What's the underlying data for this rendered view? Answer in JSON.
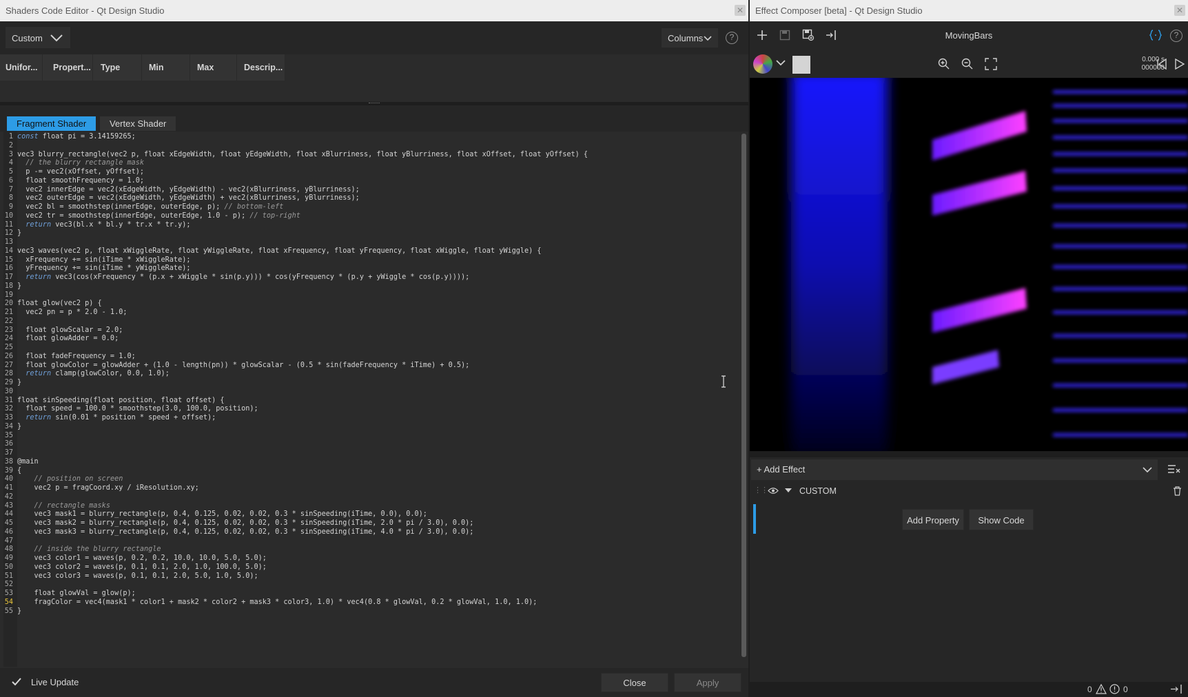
{
  "left_window": {
    "title": "Shaders Code Editor - Qt Design Studio",
    "close_glyph": "✕",
    "mode_combo": "Custom",
    "columns_button": "Columns",
    "help_glyph": "?",
    "table_headers": [
      "Unifor...",
      "Propert...",
      "Type",
      "Min",
      "Max",
      "Descrip..."
    ],
    "tabs": [
      "Fragment Shader",
      "Vertex Shader"
    ],
    "live_update_label": "Live Update",
    "close_button": "Close",
    "apply_button": "Apply",
    "current_line": 54
  },
  "code_lines": [
    "const float pi = 3.14159265;",
    "",
    "vec3 blurry_rectangle(vec2 p, float xEdgeWidth, float yEdgeWidth, float xBlurriness, float yBlurriness, float xOffset, float yOffset) {",
    "  // the blurry rectangle mask",
    "  p -= vec2(xOffset, yOffset);",
    "  float smoothFrequency = 1.0;",
    "  vec2 innerEdge = vec2(xEdgeWidth, yEdgeWidth) - vec2(xBlurriness, yBlurriness);",
    "  vec2 outerEdge = vec2(xEdgeWidth, yEdgeWidth) + vec2(xBlurriness, yBlurriness);",
    "  vec2 bl = smoothstep(innerEdge, outerEdge, p); // bottom-left",
    "  vec2 tr = smoothstep(innerEdge, outerEdge, 1.0 - p); // top-right",
    "  return vec3(bl.x * bl.y * tr.x * tr.y);",
    "}",
    "",
    "vec3 waves(vec2 p, float xWiggleRate, float yWiggleRate, float xFrequency, float yFrequency, float xWiggle, float yWiggle) {",
    "  xFrequency += sin(iTime * xWiggleRate);",
    "  yFrequency += sin(iTime * yWiggleRate);",
    "  return vec3(cos(xFrequency * (p.x + xWiggle * sin(p.y))) * cos(yFrequency * (p.y + yWiggle * cos(p.y))));",
    "}",
    "",
    "float glow(vec2 p) {",
    "  vec2 pn = p * 2.0 - 1.0;",
    "",
    "  float glowScalar = 2.0;",
    "  float glowAdder = 0.0;",
    "",
    "  float fadeFrequency = 1.0;",
    "  float glowColor = glowAdder + (1.0 - length(pn)) * glowScalar - (0.5 * sin(fadeFrequency * iTime) + 0.5);",
    "  return clamp(glowColor, 0.0, 1.0);",
    "}",
    "",
    "float sinSpeeding(float position, float offset) {",
    "  float speed = 100.0 * smoothstep(3.0, 100.0, position);",
    "  return sin(0.01 * position * speed + offset);",
    "}",
    "",
    "",
    "",
    "@main",
    "{",
    "    // position on screen",
    "    vec2 p = fragCoord.xy / iResolution.xy;",
    "",
    "    // rectangle masks",
    "    vec3 mask1 = blurry_rectangle(p, 0.4, 0.125, 0.02, 0.02, 0.3 * sinSpeeding(iTime, 0.0), 0.0);",
    "    vec3 mask2 = blurry_rectangle(p, 0.4, 0.125, 0.02, 0.02, 0.3 * sinSpeeding(iTime, 2.0 * pi / 3.0), 0.0);",
    "    vec3 mask3 = blurry_rectangle(p, 0.4, 0.125, 0.02, 0.02, 0.3 * sinSpeeding(iTime, 4.0 * pi / 3.0), 0.0);",
    "",
    "    // inside the blurry rectangle",
    "    vec3 color1 = waves(p, 0.2, 0.2, 10.0, 10.0, 5.0, 5.0);",
    "    vec3 color2 = waves(p, 0.1, 0.1, 2.0, 1.0, 100.0, 5.0);",
    "    vec3 color3 = waves(p, 0.1, 0.1, 2.0, 5.0, 1.0, 5.0);",
    "",
    "    float glowVal = glow(p);",
    "    fragColor = vec4(mask1 * color1 + mask2 * color2 + mask3 * color3, 1.0) * vec4(0.8 * glowVal, 0.2 * glowVal, 1.0, 1.0);",
    "}"
  ],
  "right_window": {
    "title": "Effect Composer [beta] - Qt Design Studio",
    "close_glyph": "✕",
    "composition_name": "MovingBars",
    "time_seconds": "0.000 s",
    "time_frame": "000000",
    "add_effect_label": "+ Add Effect",
    "effect_node_name": "CUSTOM",
    "add_property_button": "Add Property",
    "show_code_button": "Show Code",
    "warning_count": "0",
    "error_count": "0"
  },
  "icons": {
    "toolbar": [
      "plus-icon",
      "save-icon",
      "save-as-icon",
      "assign-to-selected-icon",
      "code-icon",
      "help-icon"
    ],
    "preview": [
      "background-image-icon",
      "chevron-down-icon",
      "color-swatch-icon",
      "zoom-in-icon",
      "zoom-out-icon",
      "fit-icon",
      "restart-icon",
      "play-icon"
    ]
  },
  "colors": {
    "accent": "#2d9ce6",
    "current_line_number": "#e8c43a",
    "keyword": "#6f9fd8",
    "comment": "#9a9a9a"
  }
}
